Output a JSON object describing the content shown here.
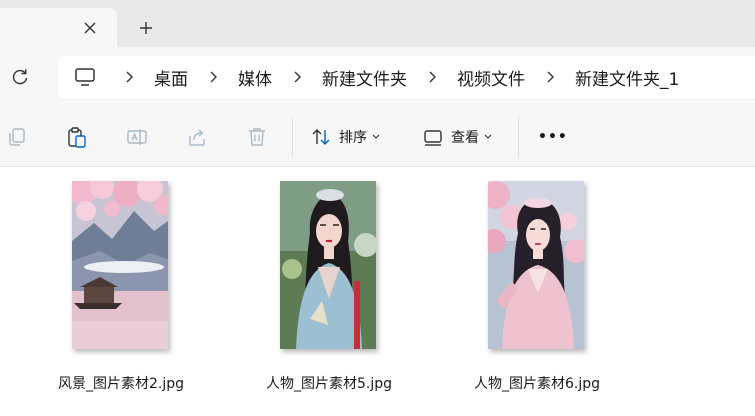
{
  "window": {
    "tab_close_icon": "close-icon",
    "new_tab_icon": "plus-icon"
  },
  "address": {
    "root_icon": "computer-icon",
    "breadcrumbs": [
      "桌面",
      "媒体",
      "新建文件夹",
      "视频文件",
      "新建文件夹_1"
    ]
  },
  "toolbar": {
    "sort_label": "排序",
    "view_label": "查看",
    "more_label": "•••"
  },
  "files": [
    {
      "name": "风景_图片素材2.jpg",
      "kind": "landscape"
    },
    {
      "name": "人物_图片素材5.jpg",
      "kind": "portrait-blue"
    },
    {
      "name": "人物_图片素材6.jpg",
      "kind": "portrait-pink"
    }
  ],
  "colors": {
    "accent": "#0067c0",
    "disabled_icon": "#a8b8c8",
    "tab_strip": "#e9e9e9",
    "chrome": "#f7f7f7"
  }
}
